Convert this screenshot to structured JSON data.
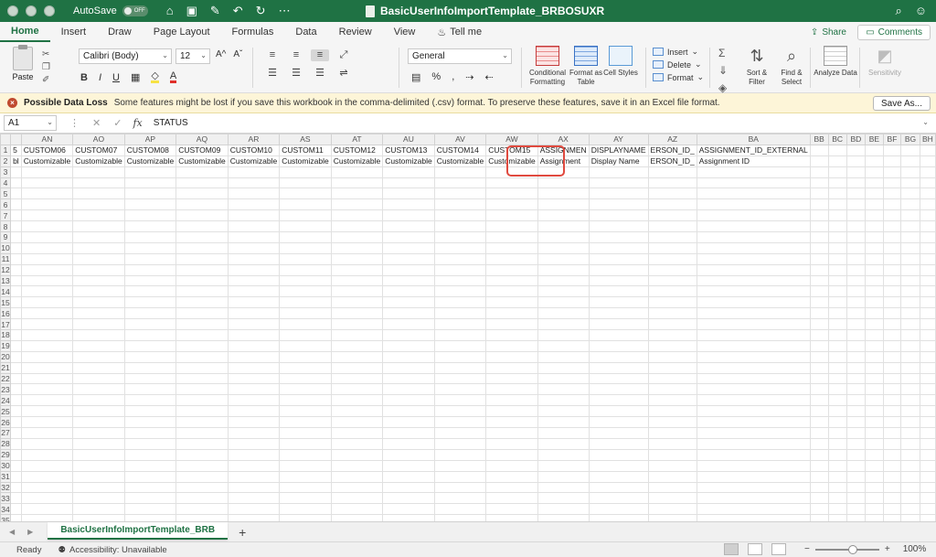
{
  "titlebar": {
    "autosave_label": "AutoSave",
    "autosave_state": "OFF",
    "title": "BasicUserInfoImportTemplate_BRBOSUXR",
    "icons": [
      "home-icon",
      "save-icon",
      "save-as-icon",
      "undo-icon",
      "redo-icon",
      "more-icon",
      "search-icon",
      "share-person-icon"
    ]
  },
  "tabs": {
    "items": [
      "Home",
      "Insert",
      "Draw",
      "Page Layout",
      "Formulas",
      "Data",
      "Review",
      "View"
    ],
    "active": "Home",
    "tell_me": "Tell me",
    "share": "Share",
    "comments": "Comments"
  },
  "ribbon": {
    "paste": "Paste",
    "font_name": "Calibri (Body)",
    "font_size": "12",
    "number_format": "General",
    "conditional_formatting": "Conditional Formatting",
    "format_as_table": "Format as Table",
    "cell_styles": "Cell Styles",
    "insert": "Insert",
    "delete": "Delete",
    "format": "Format",
    "sort_filter": "Sort & Filter",
    "find_select": "Find & Select",
    "analyze_data": "Analyze Data",
    "sensitivity": "Sensitivity",
    "bold": "B",
    "italic": "I",
    "underline": "U",
    "grow_font": "A^",
    "shrink_font": "Aˇ",
    "font_color_glyph": "A",
    "percent": "%",
    "comma": ","
  },
  "message_bar": {
    "title": "Possible Data Loss",
    "text": "Some features might be lost if you save this workbook in the comma-delimited (.csv) format. To preserve these features, save it in an Excel file format.",
    "button": "Save As..."
  },
  "formula_bar": {
    "name_box": "A1",
    "fx": "fx",
    "value": "STATUS"
  },
  "sheet": {
    "columns": [
      "",
      "AN",
      "AO",
      "AP",
      "AQ",
      "AR",
      "AS",
      "AT",
      "AU",
      "AV",
      "AW",
      "AX",
      "AY",
      "AZ",
      "BA",
      "BB",
      "BC",
      "BD",
      "BE",
      "BF",
      "BG",
      "BH"
    ],
    "row1": [
      "5",
      "CUSTOM06",
      "CUSTOM07",
      "CUSTOM08",
      "CUSTOM09",
      "CUSTOM10",
      "CUSTOM11",
      "CUSTOM12",
      "CUSTOM13",
      "CUSTOM14",
      "CUSTOM15",
      "ASSIGNMEN",
      "DISPLAYNAME",
      "ERSON_ID_",
      "ASSIGNMENT_ID_EXTERNAL",
      "",
      "",
      "",
      "",
      "",
      "",
      ""
    ],
    "row2": [
      "bl",
      "Customizable",
      "Customizable",
      "Customizable",
      "Customizable",
      "Customizable",
      "Customizable",
      "Customizable",
      "Customizable",
      "Customizable",
      "Customizable",
      "Assignment",
      "Display Name",
      "ERSON_ID_",
      "Assignment ID",
      "",
      "",
      "",
      "",
      "",
      "",
      ""
    ],
    "row_count": 35,
    "accent_highlight": "#e04a3f"
  },
  "sheet_tabs": {
    "active": "BasicUserInfoImportTemplate_BRB",
    "add": "+"
  },
  "status": {
    "ready": "Ready",
    "accessibility": "Accessibility: Unavailable",
    "zoom": "100%",
    "zoom_minus": "−",
    "zoom_plus": "+"
  },
  "colors": {
    "brand": "#1f7244",
    "message_bg": "#fdf5d8"
  }
}
